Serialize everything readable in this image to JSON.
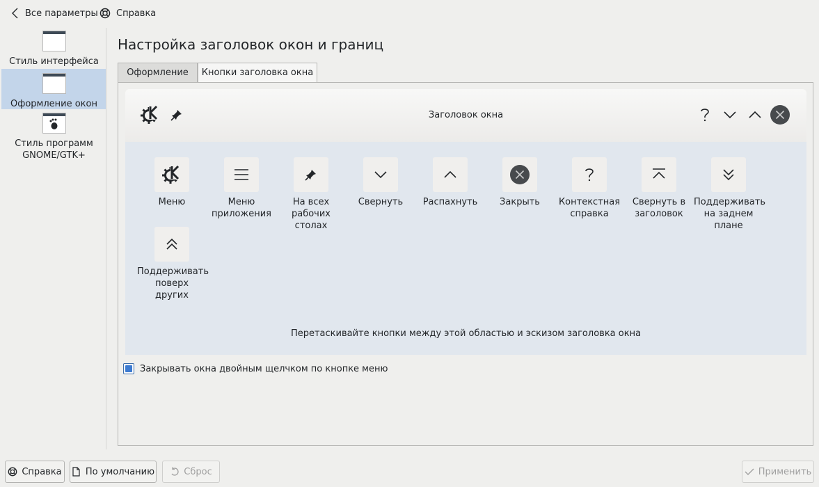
{
  "topbar": {
    "back_label": "Все параметры",
    "help_label": "Справка"
  },
  "sidebar": {
    "items": [
      {
        "label": "Стиль интерфейса"
      },
      {
        "label": "Оформление окон"
      },
      {
        "label": "Стиль программ GNOME/GTK+"
      }
    ]
  },
  "page_title": "Настройка заголовок окон и границ",
  "tabs": [
    {
      "label": "Оформление"
    },
    {
      "label": "Кнопки заголовка окна"
    }
  ],
  "preview": {
    "title": "Заголовок окна"
  },
  "available_buttons": [
    {
      "label": "Меню",
      "icon": "kde-logo-icon"
    },
    {
      "label": "Меню приложения",
      "icon": "hamburger-menu-icon"
    },
    {
      "label": "На всех рабочих столах",
      "icon": "pin-icon"
    },
    {
      "label": "Свернуть",
      "icon": "chevron-down-icon"
    },
    {
      "label": "Распахнуть",
      "icon": "chevron-up-icon"
    },
    {
      "label": "Закрыть",
      "icon": "close-circle-icon"
    },
    {
      "label": "Контекстная справка",
      "icon": "question-icon"
    },
    {
      "label": "Свернуть в заголовок",
      "icon": "shade-icon"
    },
    {
      "label": "Поддерживать на заднем плане",
      "icon": "double-chevron-down-icon"
    },
    {
      "label": "Поддерживать поверх других",
      "icon": "double-chevron-up-icon"
    }
  ],
  "hint": "Перетаскивайте кнопки между этой областью и эскизом заголовка окна",
  "checkbox": {
    "label": "Закрывать окна двойным щелчком по кнопке меню",
    "checked": true
  },
  "footer": {
    "help_label": "Справка",
    "defaults_label": "По умолчанию",
    "reset_label": "Сброс",
    "apply_label": "Применить"
  },
  "colors": {
    "accent": "#3d7bd1",
    "selection": "#c3d5ea"
  }
}
